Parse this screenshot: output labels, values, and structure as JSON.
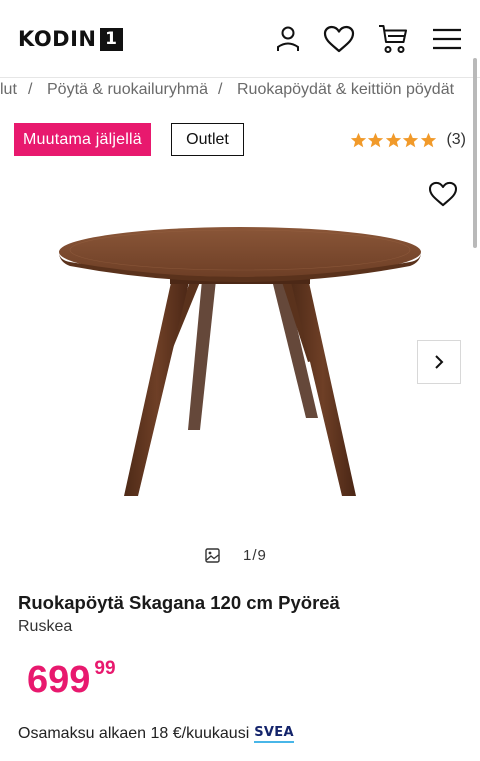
{
  "header": {
    "logo_text": "KODIN",
    "logo_badge": "1",
    "icons": [
      "account-icon",
      "wishlist-icon",
      "cart-icon",
      "menu-icon"
    ]
  },
  "breadcrumb": {
    "items": [
      "lut",
      "Pöytä & ruokailuryhmä",
      "Ruokapöydät & keittiön pöydät"
    ],
    "separator": "/"
  },
  "badges": {
    "low_stock": "Muutama jäljellä",
    "outlet": "Outlet"
  },
  "rating": {
    "stars": 5,
    "count_label": "(3)"
  },
  "gallery": {
    "counter": "1/9",
    "current": 1,
    "total": 9
  },
  "product": {
    "title": "Ruokapöytä Skagana 120 cm Pyöreä",
    "variant": "Ruskea"
  },
  "price": {
    "main": "699",
    "decimals": "99"
  },
  "installment": {
    "text": "Osamaksu alkaen 18 €/kuukausi",
    "provider": "SVEA"
  },
  "colors": {
    "accent": "#e8196e",
    "star": "#f19a2a",
    "svea_blue": "#14246b"
  }
}
